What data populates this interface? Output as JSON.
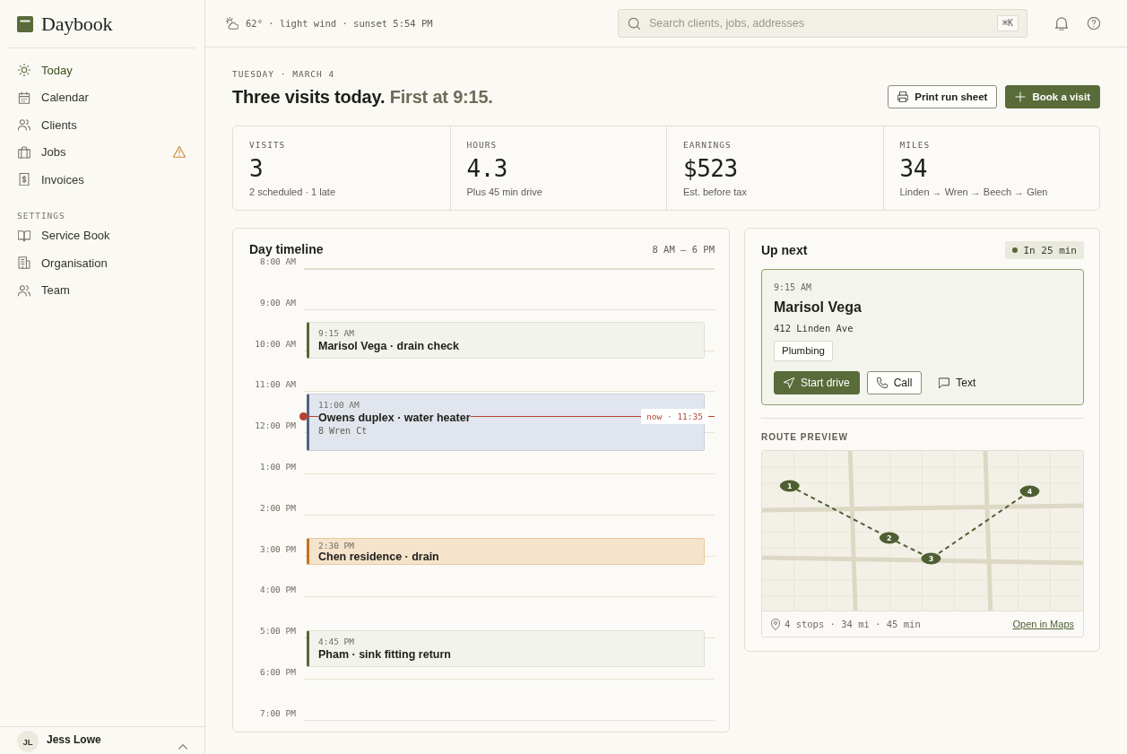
{
  "sidebar": {
    "brand": "Daybook",
    "nav": [
      {
        "label": "Today",
        "selected": true,
        "warning": false
      },
      {
        "label": "Calendar",
        "selected": false,
        "warning": false
      },
      {
        "label": "Clients",
        "selected": false,
        "warning": false
      },
      {
        "label": "Jobs",
        "selected": false,
        "warning": true
      },
      {
        "label": "Invoices",
        "selected": false,
        "warning": false
      }
    ],
    "settings_heading": "SETTINGS",
    "settings": [
      {
        "label": "Service Book",
        "selected": false
      },
      {
        "label": "Organisation",
        "selected": false
      },
      {
        "label": "Team",
        "selected": false
      }
    ],
    "user": {
      "initials": "JL",
      "name": "Jess Lowe"
    }
  },
  "topbar": {
    "weather": "62° · light wind · sunset 5:54 PM",
    "search": {
      "placeholder": "Search clients, jobs, addresses",
      "shortcut": "⌘K"
    }
  },
  "header": {
    "date": "TUESDAY · MARCH 4",
    "title": "Three visits today.",
    "title_accent": "First at 9:15.",
    "buttons": [
      {
        "label": "Print run sheet",
        "kind": "outline"
      },
      {
        "label": "Book a visit",
        "kind": "primary"
      }
    ]
  },
  "stats": [
    {
      "label": "VISITS",
      "value": "3",
      "note": "2 scheduled · 1 late"
    },
    {
      "label": "HOURS",
      "value": "4.3",
      "note": "Plus 45 min drive"
    },
    {
      "label": "EARNINGS",
      "value": "$523",
      "note": "Est. before tax"
    },
    {
      "label": "MILES",
      "value": "34",
      "note": "Linden → Wren → Beech → Glen"
    }
  ],
  "timeline": {
    "title": "Day timeline",
    "range": "8 AM — 6 PM",
    "hours": [
      "8:00 AM",
      "9:00 AM",
      "10:00 AM",
      "11:00 AM",
      "12:00 PM",
      "1:00 PM",
      "2:00 PM",
      "3:00 PM",
      "4:00 PM",
      "5:00 PM",
      "6:00 PM",
      "7:00 PM"
    ],
    "events": [
      {
        "time": "9:15 AM",
        "title": "Marisol Vega · drain check",
        "kind": "scheduled"
      },
      {
        "time": "11:00 AM",
        "title": "Owens duplex · water heater",
        "address": "8 Wren Ct",
        "kind": "current"
      },
      {
        "time": "2:30 PM",
        "title": "Chen residence · drain",
        "kind": "late"
      },
      {
        "time": "4:45 PM",
        "title": "Pham · sink fitting return",
        "kind": "scheduled"
      }
    ],
    "now_marker": {
      "label": "now · 11:35"
    }
  },
  "up_next": {
    "title": "Up next",
    "badge": "In 25 min",
    "visit": {
      "time": "9:15 AM",
      "client": "Marisol Vega",
      "address": "412 Linden Ave",
      "tag": "Plumbing",
      "actions": [
        {
          "label": "Start drive",
          "kind": "primary"
        },
        {
          "label": "Call",
          "kind": "outline"
        },
        {
          "label": "Text",
          "kind": "plain"
        }
      ]
    },
    "route": {
      "title": "ROUTE PREVIEW",
      "stops": [
        "1",
        "2",
        "3",
        "4"
      ],
      "summary": "4 stops · 34 mi · 45 min",
      "link": "Open in Maps"
    }
  }
}
